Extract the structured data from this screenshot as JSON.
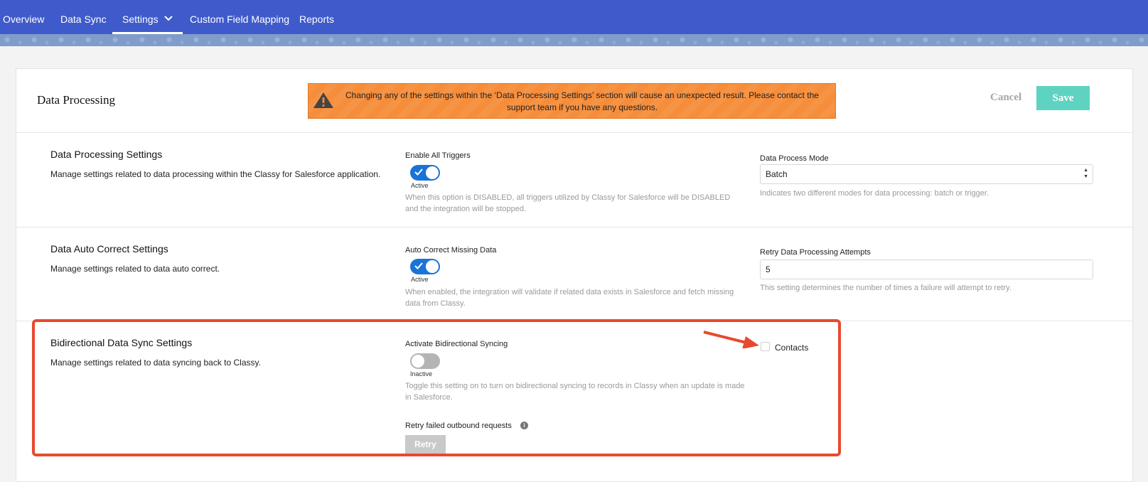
{
  "nav": {
    "tabs": [
      "Overview",
      "Data Sync",
      "Settings",
      "Custom Field Mapping",
      "Reports"
    ],
    "active": "Settings"
  },
  "header": {
    "title": "Data Processing",
    "warning": "Changing any of the settings within the ‘Data Processing Settings’ section will cause an unexpected result. Please contact the support team if you have any questions.",
    "cancel": "Cancel",
    "save": "Save"
  },
  "sections": {
    "processing": {
      "title": "Data Processing Settings",
      "description": "Manage settings related to data processing within the Classy for Salesforce application.",
      "toggle_label": "Enable All Triggers",
      "toggle_state": "Active",
      "toggle_on": true,
      "toggle_help": "When this option is DISABLED, all triggers utilized by Classy for Salesforce will be DISABLED and the integration will be stopped.",
      "mode_label": "Data Process Mode",
      "mode_value": "Batch",
      "mode_help": "Indicates two different modes for data processing: batch or trigger."
    },
    "autocorrect": {
      "title": "Data Auto Correct Settings",
      "description": "Manage settings related to data auto correct.",
      "toggle_label": "Auto Correct Missing Data",
      "toggle_state": "Active",
      "toggle_on": true,
      "toggle_help": "When enabled, the integration will validate if related data exists in Salesforce and fetch missing data from Classy.",
      "retry_label": "Retry Data Processing Attempts",
      "retry_value": "5",
      "retry_help": "This setting determines the number of times a failure will attempt to retry."
    },
    "bidirectional": {
      "title": "Bidirectional Data Sync Settings",
      "description": "Manage settings related to data syncing back to Classy.",
      "toggle_label": "Activate Bidirectional Syncing",
      "toggle_state": "Inactive",
      "toggle_on": false,
      "toggle_help": "Toggle this setting on to turn on bidirectional syncing to records in Classy when an update is made in Salesforce.",
      "checkbox_label": "Contacts",
      "checkbox_checked": false,
      "retry_outbound_label": "Retry failed outbound requests",
      "retry_button": "Retry"
    }
  },
  "colors": {
    "nav": "#3f5bcb",
    "warning": "#f68d3a",
    "save": "#5fd3c1",
    "toggle_on": "#1a73d6",
    "highlight": "#e64a2e"
  }
}
